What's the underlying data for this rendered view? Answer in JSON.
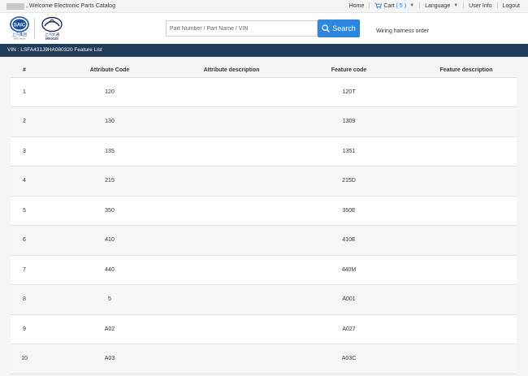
{
  "topbar": {
    "welcome": ", Welcome Electronic Parts Catalog",
    "home": "Home",
    "cart_label": "Cart",
    "cart_count": "( 5 )",
    "language": "Language",
    "user_info": "User Info",
    "logout": "Logout"
  },
  "header": {
    "search_placeholder": "Part Number / Part Name / VIN",
    "search_button": "Search",
    "wiring_link": "Wiring harness order",
    "saic_logo_text": "SAIC",
    "saic_cn": "上汽集团",
    "saic_en": "SAIC Motor",
    "maxus_cn": "上汽大通",
    "maxus_en": "MAXUS"
  },
  "vin_bar": "VIN : LSFA431J9HA080320 Feature List",
  "table": {
    "headers": [
      "#",
      "Attribute Code",
      "Attribute description",
      "Feature code",
      "Feature description"
    ],
    "rows": [
      [
        "1",
        "120",
        "",
        "120T",
        ""
      ],
      [
        "2",
        "130",
        "",
        "1309",
        ""
      ],
      [
        "3",
        "135",
        "",
        "1351",
        ""
      ],
      [
        "4",
        "215",
        "",
        "215D",
        ""
      ],
      [
        "5",
        "350",
        "",
        "350E",
        ""
      ],
      [
        "6",
        "410",
        "",
        "410E",
        ""
      ],
      [
        "7",
        "440",
        "",
        "440M",
        ""
      ],
      [
        "8",
        "5",
        "",
        "A001",
        ""
      ],
      [
        "9",
        "A02",
        "",
        "A027",
        ""
      ],
      [
        "10",
        "A03",
        "",
        "A03C",
        ""
      ]
    ]
  },
  "colors": {
    "accent": "#2e86de",
    "vin_bar": "#1f3b5a",
    "saic_blue": "#1a4f9c",
    "maxus_navy": "#1f2f5c"
  }
}
